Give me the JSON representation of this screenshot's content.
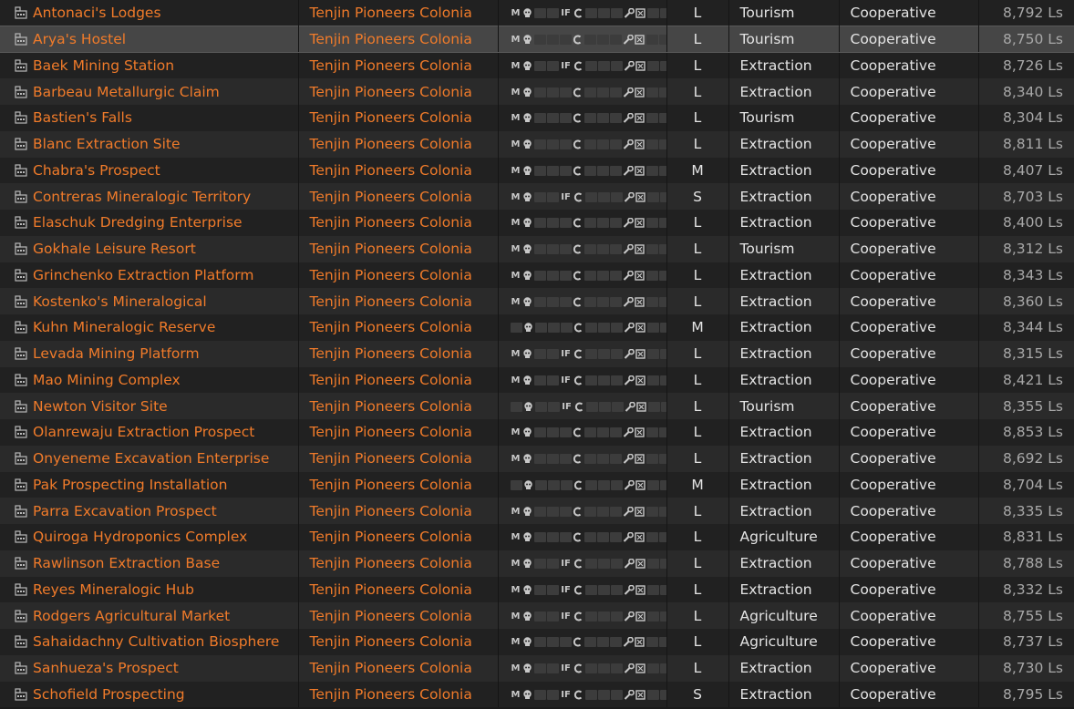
{
  "table": {
    "system_default": "Tenjin Pioneers Colonia",
    "government_default": "Cooperative",
    "rows": [
      {
        "name": "Antonaci's Lodges",
        "system": "Tenjin Pioneers Colonia",
        "services": "M,S,_,_,IF,C,_,_,_,W,X,_,_",
        "pad": "L",
        "economy": "Tourism",
        "government": "Cooperative",
        "distance": "8,792 Ls"
      },
      {
        "name": "Arya's Hostel",
        "system": "Tenjin Pioneers Colonia",
        "services": "M,S,_,_,_,C,_,_,_,W,X,_,_",
        "pad": "L",
        "economy": "Tourism",
        "government": "Cooperative",
        "distance": "8,750 Ls",
        "selected": true
      },
      {
        "name": "Baek Mining Station",
        "system": "Tenjin Pioneers Colonia",
        "services": "M,S,_,_,IF,C,_,_,_,W,X,_,_",
        "pad": "L",
        "economy": "Extraction",
        "government": "Cooperative",
        "distance": "8,726 Ls"
      },
      {
        "name": "Barbeau Metallurgic Claim",
        "system": "Tenjin Pioneers Colonia",
        "services": "M,S,_,_,_,C,_,_,_,W,X,_,_",
        "pad": "L",
        "economy": "Extraction",
        "government": "Cooperative",
        "distance": "8,340 Ls"
      },
      {
        "name": "Bastien's Falls",
        "system": "Tenjin Pioneers Colonia",
        "services": "M,S,_,_,_,C,_,_,_,W,X,_,_",
        "pad": "L",
        "economy": "Tourism",
        "government": "Cooperative",
        "distance": "8,304 Ls"
      },
      {
        "name": "Blanc Extraction Site",
        "system": "Tenjin Pioneers Colonia",
        "services": "M,S,_,_,_,C,_,_,_,W,X,_,_",
        "pad": "L",
        "economy": "Extraction",
        "government": "Cooperative",
        "distance": "8,811 Ls"
      },
      {
        "name": "Chabra's Prospect",
        "system": "Tenjin Pioneers Colonia",
        "services": "M,S,_,_,_,C,_,_,_,W,X,_,_",
        "pad": "M",
        "economy": "Extraction",
        "government": "Cooperative",
        "distance": "8,407 Ls"
      },
      {
        "name": "Contreras Mineralogic Territory",
        "system": "Tenjin Pioneers Colonia",
        "services": "M,S,_,_,IF,C,_,_,_,W,X,_,_",
        "pad": "S",
        "economy": "Extraction",
        "government": "Cooperative",
        "distance": "8,703 Ls"
      },
      {
        "name": "Elaschuk Dredging Enterprise",
        "system": "Tenjin Pioneers Colonia",
        "services": "M,S,_,_,_,C,_,_,_,W,X,_,_",
        "pad": "L",
        "economy": "Extraction",
        "government": "Cooperative",
        "distance": "8,400 Ls"
      },
      {
        "name": "Gokhale Leisure Resort",
        "system": "Tenjin Pioneers Colonia",
        "services": "M,S,_,_,_,C,_,_,_,W,X,_,_",
        "pad": "L",
        "economy": "Tourism",
        "government": "Cooperative",
        "distance": "8,312 Ls"
      },
      {
        "name": "Grinchenko Extraction Platform",
        "system": "Tenjin Pioneers Colonia",
        "services": "M,S,_,_,_,C,_,_,_,W,X,_,_",
        "pad": "L",
        "economy": "Extraction",
        "government": "Cooperative",
        "distance": "8,343 Ls"
      },
      {
        "name": "Kostenko's Mineralogical",
        "system": "Tenjin Pioneers Colonia",
        "services": "M,S,_,_,_,C,_,_,_,W,X,_,_",
        "pad": "L",
        "economy": "Extraction",
        "government": "Cooperative",
        "distance": "8,360 Ls"
      },
      {
        "name": "Kuhn Mineralogic Reserve",
        "system": "Tenjin Pioneers Colonia",
        "services": "_,S,_,_,_,C,_,_,_,W,X,_,_",
        "pad": "M",
        "economy": "Extraction",
        "government": "Cooperative",
        "distance": "8,344 Ls"
      },
      {
        "name": "Levada Mining Platform",
        "system": "Tenjin Pioneers Colonia",
        "services": "M,S,_,_,IF,C,_,_,_,W,X,_,_",
        "pad": "L",
        "economy": "Extraction",
        "government": "Cooperative",
        "distance": "8,315 Ls"
      },
      {
        "name": "Mao Mining Complex",
        "system": "Tenjin Pioneers Colonia",
        "services": "M,S,_,_,IF,C,_,_,_,W,X,_,_",
        "pad": "L",
        "economy": "Extraction",
        "government": "Cooperative",
        "distance": "8,421 Ls"
      },
      {
        "name": "Newton Visitor Site",
        "system": "Tenjin Pioneers Colonia",
        "services": "_,S,_,_,IF,C,_,_,_,W,X,_,_",
        "pad": "L",
        "economy": "Tourism",
        "government": "Cooperative",
        "distance": "8,355 Ls"
      },
      {
        "name": "Olanrewaju Extraction Prospect",
        "system": "Tenjin Pioneers Colonia",
        "services": "M,S,_,_,_,C,_,_,_,W,X,_,_",
        "pad": "L",
        "economy": "Extraction",
        "government": "Cooperative",
        "distance": "8,853 Ls"
      },
      {
        "name": "Onyeneme Excavation Enterprise",
        "system": "Tenjin Pioneers Colonia",
        "services": "M,S,_,_,_,C,_,_,_,W,X,_,_",
        "pad": "L",
        "economy": "Extraction",
        "government": "Cooperative",
        "distance": "8,692 Ls"
      },
      {
        "name": "Pak Prospecting Installation",
        "system": "Tenjin Pioneers Colonia",
        "services": "_,S,_,_,_,C,_,_,_,W,X,_,_",
        "pad": "M",
        "economy": "Extraction",
        "government": "Cooperative",
        "distance": "8,704 Ls"
      },
      {
        "name": "Parra Excavation Prospect",
        "system": "Tenjin Pioneers Colonia",
        "services": "M,S,_,_,_,C,_,_,_,W,X,_,_",
        "pad": "L",
        "economy": "Extraction",
        "government": "Cooperative",
        "distance": "8,335 Ls"
      },
      {
        "name": "Quiroga Hydroponics Complex",
        "system": "Tenjin Pioneers Colonia",
        "services": "M,S,_,_,_,C,_,_,_,W,X,_,_",
        "pad": "L",
        "economy": "Agriculture",
        "government": "Cooperative",
        "distance": "8,831 Ls"
      },
      {
        "name": "Rawlinson Extraction Base",
        "system": "Tenjin Pioneers Colonia",
        "services": "M,S,_,_,IF,C,_,_,_,W,X,_,_",
        "pad": "L",
        "economy": "Extraction",
        "government": "Cooperative",
        "distance": "8,788 Ls"
      },
      {
        "name": "Reyes Mineralogic Hub",
        "system": "Tenjin Pioneers Colonia",
        "services": "M,S,_,_,IF,C,_,_,_,W,X,_,_",
        "pad": "L",
        "economy": "Extraction",
        "government": "Cooperative",
        "distance": "8,332 Ls"
      },
      {
        "name": "Rodgers Agricultural Market",
        "system": "Tenjin Pioneers Colonia",
        "services": "M,S,_,_,IF,C,_,_,_,W,X,_,_",
        "pad": "L",
        "economy": "Agriculture",
        "government": "Cooperative",
        "distance": "8,755 Ls"
      },
      {
        "name": "Sahaidachny Cultivation Biosphere",
        "system": "Tenjin Pioneers Colonia",
        "services": "M,S,_,_,_,C,_,_,_,W,X,_,_",
        "pad": "L",
        "economy": "Agriculture",
        "government": "Cooperative",
        "distance": "8,737 Ls"
      },
      {
        "name": "Sanhueza's Prospect",
        "system": "Tenjin Pioneers Colonia",
        "services": "M,S,_,_,IF,C,_,_,_,W,X,_,_",
        "pad": "L",
        "economy": "Extraction",
        "government": "Cooperative",
        "distance": "8,730 Ls"
      },
      {
        "name": "Schofield Prospecting",
        "system": "Tenjin Pioneers Colonia",
        "services": "M,S,_,_,IF,C,_,_,_,W,X,_,_",
        "pad": "S",
        "economy": "Extraction",
        "government": "Cooperative",
        "distance": "8,795 Ls"
      }
    ]
  },
  "icons": {
    "station": "station-icon",
    "services": {
      "M": "market-icon",
      "S": "shipyard-skull-icon",
      "IF": "interstellar-factors-icon",
      "C": "contacts-icon",
      "W": "repair-wrench-icon",
      "X": "restock-icon"
    }
  },
  "colors": {
    "link": "#f07b2a",
    "row_odd": "#212121",
    "row_even": "#2a2a2a",
    "row_selected": "#464646",
    "text": "#e4e4e4",
    "distance": "#a8a8a8"
  }
}
